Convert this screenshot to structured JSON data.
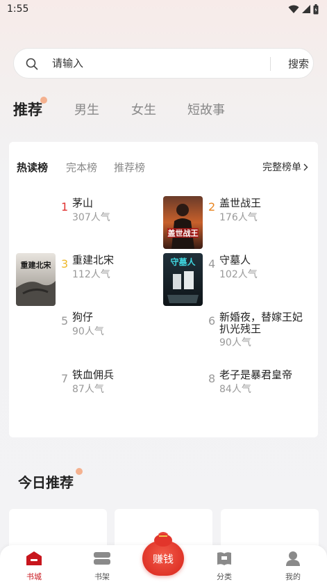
{
  "status": {
    "time": "1:55"
  },
  "search": {
    "placeholder": "请输入",
    "button": "搜索"
  },
  "tabs": [
    {
      "label": "推荐",
      "active": true
    },
    {
      "label": "男生",
      "active": false
    },
    {
      "label": "女生",
      "active": false
    },
    {
      "label": "短故事",
      "active": false
    }
  ],
  "ranking": {
    "tabs": [
      "热读榜",
      "完本榜",
      "推荐榜"
    ],
    "more": "完整榜单",
    "items": [
      {
        "rank": "1",
        "title": "茅山",
        "popularity": "307人气",
        "cover": "none",
        "rank_color": "#e0312f"
      },
      {
        "rank": "2",
        "title": "盖世战王",
        "popularity": "176人气",
        "cover": "盖世战王",
        "rank_color": "#e8841f"
      },
      {
        "rank": "3",
        "title": "重建北宋",
        "popularity": "112人气",
        "cover": "重建北宋",
        "rank_color": "#efb82a"
      },
      {
        "rank": "4",
        "title": "守墓人",
        "popularity": "102人气",
        "cover": "守墓人",
        "rank_color": "#999999"
      },
      {
        "rank": "5",
        "title": "狗仔",
        "popularity": "90人气",
        "cover": "none",
        "rank_color": "#999999"
      },
      {
        "rank": "6",
        "title": "新婚夜，替嫁王妃扒光残王",
        "popularity": "90人气",
        "cover": "none",
        "rank_color": "#999999"
      },
      {
        "rank": "7",
        "title": "铁血佣兵",
        "popularity": "87人气",
        "cover": "none",
        "rank_color": "#999999"
      },
      {
        "rank": "8",
        "title": "老子是暴君皇帝",
        "popularity": "84人气",
        "cover": "none",
        "rank_color": "#999999"
      }
    ]
  },
  "today": {
    "title": "今日推荐"
  },
  "nav": {
    "items": [
      {
        "label": "书城",
        "icon": "home-icon",
        "active": true
      },
      {
        "label": "书架",
        "icon": "bookshelf-icon",
        "active": false
      },
      {
        "label": "赚钱",
        "icon": "money-bag-icon",
        "active": false
      },
      {
        "label": "分类",
        "icon": "category-icon",
        "active": false
      },
      {
        "label": "我的",
        "icon": "profile-icon",
        "active": false
      }
    ]
  },
  "colors": {
    "accent": "#c8161d",
    "earn": "#e23a2c",
    "dot": "#f4b18f"
  }
}
